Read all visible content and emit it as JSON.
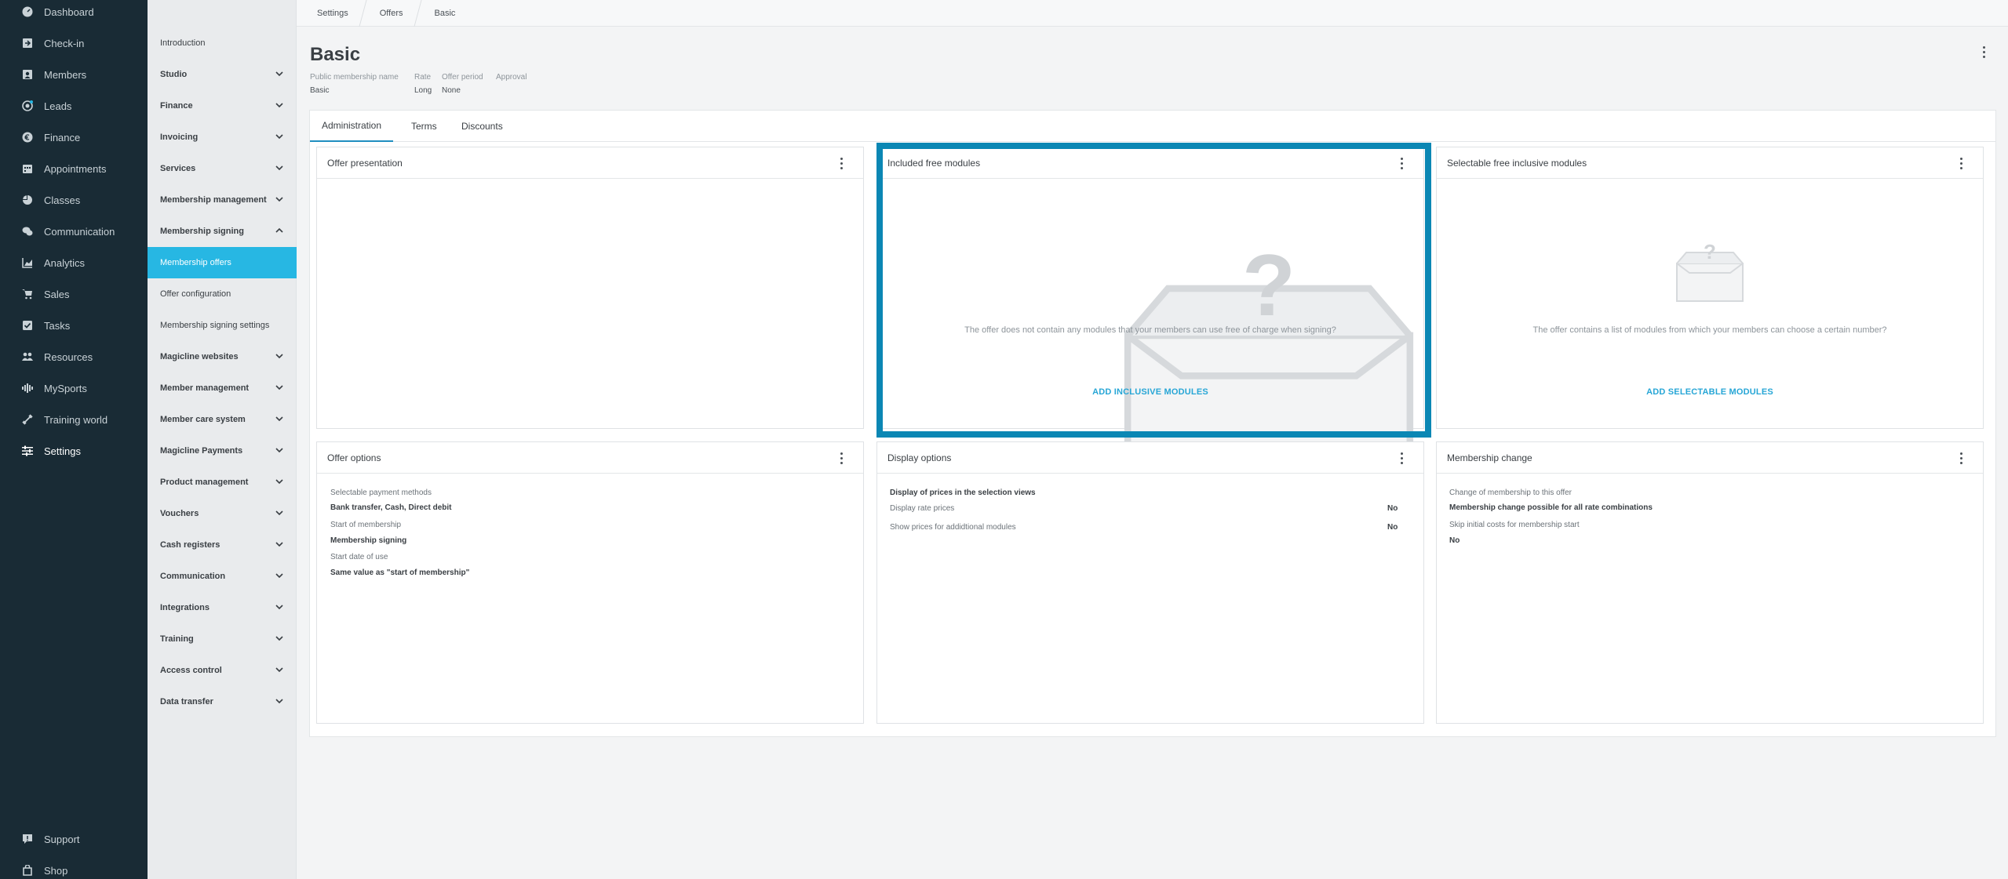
{
  "mainnav": {
    "items": [
      {
        "label": "Dashboard",
        "icon": "dashboard-icon"
      },
      {
        "label": "Check-in",
        "icon": "check-in-icon"
      },
      {
        "label": "Members",
        "icon": "members-icon"
      },
      {
        "label": "Leads",
        "icon": "leads-icon"
      },
      {
        "label": "Finance",
        "icon": "finance-icon"
      },
      {
        "label": "Appointments",
        "icon": "calendar-icon"
      },
      {
        "label": "Classes",
        "icon": "classes-icon"
      },
      {
        "label": "Communication",
        "icon": "chat-icon"
      },
      {
        "label": "Analytics",
        "icon": "chart-icon"
      },
      {
        "label": "Sales",
        "icon": "cart-icon"
      },
      {
        "label": "Tasks",
        "icon": "checkbox-icon"
      },
      {
        "label": "Resources",
        "icon": "resources-icon"
      },
      {
        "label": "MySports",
        "icon": "mysports-icon"
      },
      {
        "label": "Training world",
        "icon": "dumbbell-icon"
      },
      {
        "label": "Settings",
        "icon": "sliders-icon"
      }
    ],
    "bottom": [
      {
        "label": "Support",
        "icon": "support-icon"
      },
      {
        "label": "Shop",
        "icon": "shop-icon"
      }
    ]
  },
  "subnav": {
    "items": [
      {
        "label": "Introduction"
      },
      {
        "label": "Studio"
      },
      {
        "label": "Finance"
      },
      {
        "label": "Invoicing"
      },
      {
        "label": "Services"
      },
      {
        "label": "Membership management"
      },
      {
        "label": "Membership signing"
      },
      {
        "label": "Membership offers"
      },
      {
        "label": "Offer configuration"
      },
      {
        "label": "Membership signing settings"
      },
      {
        "label": "Magicline websites"
      },
      {
        "label": "Member management"
      },
      {
        "label": "Member care system"
      },
      {
        "label": "Magicline Payments"
      },
      {
        "label": "Product management"
      },
      {
        "label": "Vouchers"
      },
      {
        "label": "Cash registers"
      },
      {
        "label": "Communication"
      },
      {
        "label": "Integrations"
      },
      {
        "label": "Training"
      },
      {
        "label": "Access control"
      },
      {
        "label": "Data transfer"
      }
    ]
  },
  "breadcrumb": [
    "Settings",
    "Offers",
    "Basic"
  ],
  "header": {
    "title": "Basic",
    "meta": [
      {
        "label": "Public membership name",
        "value": "Basic"
      },
      {
        "label": "Rate",
        "value": "Long"
      },
      {
        "label": "Offer period",
        "value": "None"
      },
      {
        "label": "Approval",
        "value": ""
      }
    ]
  },
  "tabs": [
    "Administration",
    "Terms",
    "Discounts"
  ],
  "cards": {
    "offer_presentation": {
      "title": "Offer presentation"
    },
    "included_free_modules": {
      "title": "Included free modules",
      "empty_text": "The offer does not contain any modules that your members can use free of charge when signing?",
      "action": "ADD INCLUSIVE MODULES"
    },
    "selectable_free_modules": {
      "title": "Selectable free inclusive modules",
      "empty_text": "The offer contains a list of modules from which your members can choose a certain number?",
      "action": "ADD SELECTABLE MODULES"
    },
    "offer_options": {
      "title": "Offer options",
      "rows": [
        {
          "label": "Selectable payment methods",
          "value": "Bank transfer, Cash, Direct debit"
        },
        {
          "label": "Start of membership",
          "value": "Membership signing"
        },
        {
          "label": "Start date of use",
          "value": "Same value as \"start of membership\""
        }
      ]
    },
    "display_options": {
      "title": "Display options",
      "section": "Display of prices in the selection views",
      "rows": [
        {
          "label": "Display rate prices",
          "value": "No"
        },
        {
          "label": "Show prices for addidtional modules",
          "value": "No"
        }
      ]
    },
    "membership_change": {
      "title": "Membership change",
      "rows": [
        {
          "label": "Change of membership to this offer",
          "value": "Membership change possible for all rate combinations"
        },
        {
          "label": "Skip initial costs for membership start",
          "value": "No"
        }
      ]
    }
  },
  "colors": {
    "nav_bg": "#192b35",
    "accent": "#27b7e3",
    "highlight": "#0b87b4"
  }
}
